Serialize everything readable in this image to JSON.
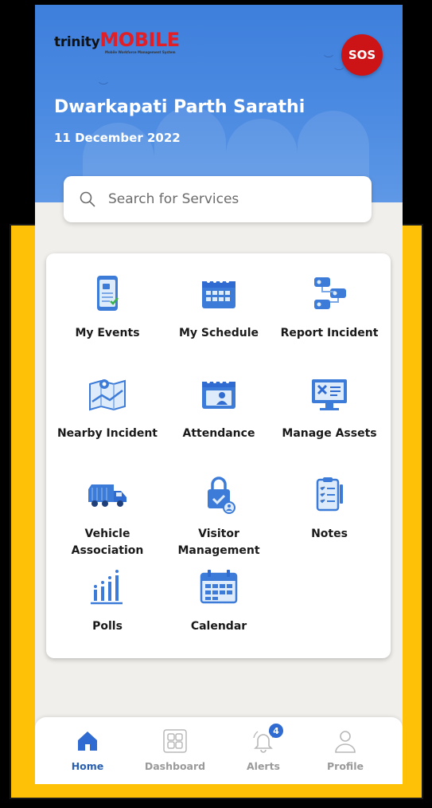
{
  "app": {
    "logo_primary": "trinity",
    "logo_secondary": "MOBILE",
    "logo_tagline": "Mobile Workforce Management System",
    "sos_label": "SOS"
  },
  "user": {
    "name": "Dwarkapati Parth Sarathi",
    "date": "11 December 2022"
  },
  "search": {
    "placeholder": "Search for Services"
  },
  "services": [
    {
      "label": "My Events",
      "icon": "events-clipboard-icon"
    },
    {
      "label": "My Schedule",
      "icon": "schedule-calendar-icon"
    },
    {
      "label": "Report Incident",
      "icon": "report-incident-icon"
    },
    {
      "label": "Nearby Incident",
      "icon": "map-location-icon"
    },
    {
      "label": "Attendance",
      "icon": "attendance-icon"
    },
    {
      "label": "Manage Assets",
      "icon": "manage-assets-icon"
    },
    {
      "label": "Vehicle\nAssociation",
      "icon": "truck-icon"
    },
    {
      "label": "Visitor\nManagement",
      "icon": "visitor-lock-icon"
    },
    {
      "label": "Notes",
      "icon": "notes-clipboard-icon"
    },
    {
      "label": "Polls",
      "icon": "polls-chart-icon"
    },
    {
      "label": "Calendar",
      "icon": "calendar-icon"
    }
  ],
  "bottom_nav": {
    "items": [
      {
        "label": "Home",
        "icon": "home-icon",
        "active": true
      },
      {
        "label": "Dashboard",
        "icon": "dashboard-icon",
        "active": false
      },
      {
        "label": "Alerts",
        "icon": "bell-icon",
        "active": false,
        "badge": "4"
      },
      {
        "label": "Profile",
        "icon": "profile-icon",
        "active": false
      }
    ]
  },
  "colors": {
    "header_blue": "#4C8BE2",
    "sos_red": "#CC1417",
    "frame_yellow": "#FFC107",
    "nav_active": "#2A5FB0",
    "icon_blue": "#3C7BD8"
  }
}
